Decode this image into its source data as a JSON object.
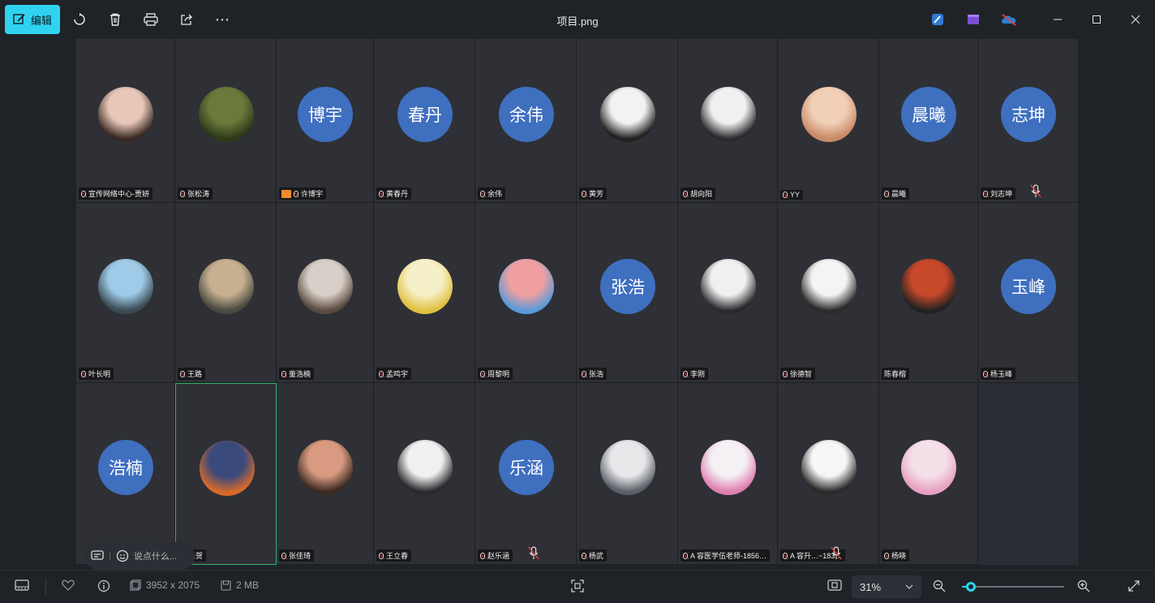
{
  "toolbar": {
    "edit_label": "编辑",
    "icons": [
      "rotate-icon",
      "delete-icon",
      "print-icon",
      "share-icon",
      "more-icon"
    ],
    "more_label": "⋯"
  },
  "title": "项目.png",
  "window_controls": [
    "minimize",
    "maximize",
    "close"
  ],
  "app_icons": [
    "designer-icon",
    "clipchamp-icon",
    "onedrive-icon"
  ],
  "accent_color": "#2fd3f0",
  "avatar_color": "#3f6fbf",
  "participants": [
    {
      "name": "宣传网络中心-贾妍",
      "type": "photo",
      "photo": "woman-photo",
      "col": 0,
      "row": 0
    },
    {
      "name": "张松涛",
      "type": "photo",
      "photo": "forest-photo",
      "col": 1,
      "row": 0
    },
    {
      "name": "许博宇",
      "type": "text",
      "avatar_text": "博宇",
      "host": true,
      "col": 2,
      "row": 0
    },
    {
      "name": "黄春丹",
      "type": "text",
      "avatar_text": "春丹",
      "col": 3,
      "row": 0
    },
    {
      "name": "余伟",
      "type": "text",
      "avatar_text": "余伟",
      "col": 4,
      "row": 0
    },
    {
      "name": "黄芳",
      "type": "photo",
      "photo": "woman-suit-photo",
      "col": 5,
      "row": 0
    },
    {
      "name": "胡向阳",
      "type": "photo",
      "photo": "man-suit-photo",
      "col": 6,
      "row": 0
    },
    {
      "name": "YY",
      "type": "photo",
      "photo": "child-photo",
      "col": 7,
      "row": 0
    },
    {
      "name": "晨曦",
      "type": "text",
      "avatar_text": "晨曦",
      "col": 8,
      "row": 0
    },
    {
      "name": "刘志坤",
      "type": "text",
      "avatar_text": "志坤",
      "col": 9,
      "row": 0,
      "muted_big": true
    },
    {
      "name": "叶长明",
      "type": "photo",
      "photo": "beach-photo",
      "col": 0,
      "row": 1
    },
    {
      "name": "王路",
      "type": "photo",
      "photo": "cat-photo",
      "col": 1,
      "row": 1
    },
    {
      "name": "董浩楠",
      "type": "photo",
      "photo": "puppies-photo",
      "col": 2,
      "row": 1
    },
    {
      "name": "孟鸣宇",
      "type": "photo",
      "photo": "illustration-photo",
      "col": 3,
      "row": 1
    },
    {
      "name": "周黎明",
      "type": "photo",
      "photo": "anime-group-photo",
      "col": 4,
      "row": 1
    },
    {
      "name": "张浩",
      "type": "text",
      "avatar_text": "张浩",
      "col": 5,
      "row": 1
    },
    {
      "name": "李刚",
      "type": "photo",
      "photo": "man-suit-photo",
      "col": 6,
      "row": 1
    },
    {
      "name": "徐德智",
      "type": "photo",
      "photo": "boy-photo",
      "col": 7,
      "row": 1
    },
    {
      "name": "陈春榕",
      "type": "photo",
      "photo": "woman-red-photo",
      "col": 8,
      "row": 1,
      "no_mic": true
    },
    {
      "name": "杨玉峰",
      "type": "text",
      "avatar_text": "玉峰",
      "col": 9,
      "row": 1
    },
    {
      "name": "",
      "type": "text",
      "avatar_text": "浩楠",
      "col": 0,
      "row": 2
    },
    {
      "name": "朱贺",
      "type": "photo",
      "photo": "cartoon-fox-photo",
      "col": 1,
      "row": 2,
      "active": true
    },
    {
      "name": "张佳琦",
      "type": "photo",
      "photo": "woman-smile-photo",
      "col": 2,
      "row": 2
    },
    {
      "name": "王立春",
      "type": "photo",
      "photo": "man-suit-photo",
      "col": 3,
      "row": 2
    },
    {
      "name": "赵乐涵",
      "type": "text",
      "avatar_text": "乐涵",
      "col": 4,
      "row": 2,
      "muted_big": true
    },
    {
      "name": "杨武",
      "type": "photo",
      "photo": "anime-boy-photo",
      "col": 5,
      "row": 2
    },
    {
      "name": "A 容医学伍老师-1856…",
      "type": "photo",
      "photo": "logo-card-photo",
      "col": 6,
      "row": 2
    },
    {
      "name": "A 容升…~183…",
      "type": "photo",
      "photo": "man-heart-photo",
      "col": 7,
      "row": 2,
      "muted_big": true
    },
    {
      "name": "杨晓",
      "type": "photo",
      "photo": "anime-girl-photo",
      "col": 8,
      "row": 2
    }
  ],
  "chat": {
    "placeholder": "说点什么..."
  },
  "bottom": {
    "dimensions": "3952 x 2075",
    "size": "2 MB",
    "zoom": "31%",
    "zoom_level": 0.09
  }
}
